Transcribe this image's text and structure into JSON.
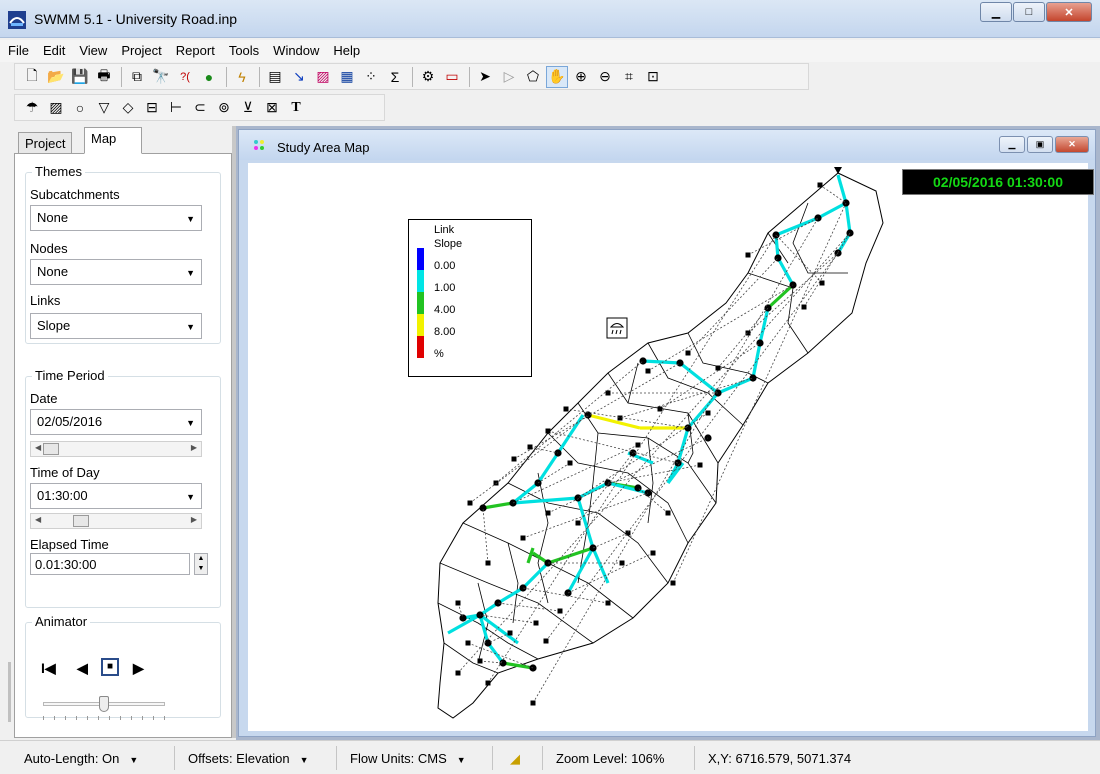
{
  "window": {
    "title": "SWMM 5.1 - University Road.inp"
  },
  "menu": [
    "File",
    "Edit",
    "View",
    "Project",
    "Report",
    "Tools",
    "Window",
    "Help"
  ],
  "toolbar_main": [
    "new-file",
    "open-file",
    "save-file",
    "print",
    "copy",
    "find",
    "query",
    "overview-map",
    "run-simulation",
    "status-report",
    "graph-profile",
    "graph-time-series",
    "table",
    "scatter-plot",
    "statistics",
    "options",
    "arrange-windows",
    "select-object",
    "select-vertex",
    "select-region",
    "pan",
    "zoom-in",
    "zoom-out",
    "full-extent",
    "measure"
  ],
  "toolbar_objects": [
    "rain-gage",
    "subcatchment",
    "junction",
    "outfall",
    "divider",
    "storage-unit",
    "conduit",
    "pump",
    "orifice",
    "weir",
    "outlet",
    "label"
  ],
  "left_panel": {
    "tabs": [
      "Project",
      "Map"
    ],
    "active_tab": "Map",
    "themes": {
      "label": "Themes",
      "subcatchments_label": "Subcatchments",
      "subcatchments_value": "None",
      "nodes_label": "Nodes",
      "nodes_value": "None",
      "links_label": "Links",
      "links_value": "Slope"
    },
    "time_period": {
      "label": "Time Period",
      "date_label": "Date",
      "date_value": "02/05/2016",
      "time_label": "Time of Day",
      "time_value": "01:30:00",
      "elapsed_label": "Elapsed Time",
      "elapsed_value": "0.01:30:00"
    },
    "animator": {
      "label": "Animator",
      "speed": 0.5
    }
  },
  "map_window": {
    "title": "Study Area Map",
    "clock": "02/05/2016 01:30:00",
    "legend": {
      "title_line1": "Link",
      "title_line2": "Slope",
      "entries": [
        {
          "value": "0.00",
          "color": "#0000ff"
        },
        {
          "value": "1.00",
          "color": "#00e5e5"
        },
        {
          "value": "4.00",
          "color": "#22c322"
        },
        {
          "value": "8.00",
          "color": "#f2f200"
        },
        {
          "value": "%",
          "color": "#e00000"
        }
      ]
    }
  },
  "status": {
    "auto_length": "Auto-Length: On",
    "offsets": "Offsets: Elevation",
    "flow_units": "Flow Units: CMS",
    "zoom": "Zoom Level: 106%",
    "xy": "X,Y: 6716.579, 5071.374"
  },
  "colors": {
    "accent": "#c7d8ee",
    "link_cyan": "#00e0e0",
    "link_green": "#22c322",
    "link_yellow": "#f2f200"
  }
}
